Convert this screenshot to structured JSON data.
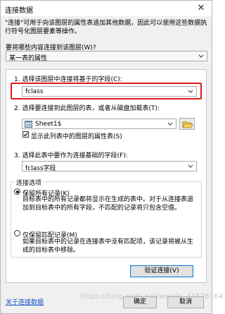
{
  "window": {
    "title": "连接数据",
    "close_glyph": "✕"
  },
  "description": "\"连接\"可用于向该图层的属性表追加其他数据，因此可以使用这些数据执行符号化图层要素等操作。",
  "what_to_join": {
    "label": "要将哪些内容连接到该图层(W)?",
    "value": "某一表的属性"
  },
  "step1": {
    "label": "1. 选择该图层中连接将基于的字段(C):",
    "value": "fclass"
  },
  "step2": {
    "label": "2. 选择要连接到此图层的表，或者从磁盘加载表(T):",
    "value": "Sheet1$",
    "show_attrs_label": "显示此列表中的图层的属性表(S)",
    "show_attrs_checked": true
  },
  "step3": {
    "label": "3. 选择此表中要作为连接基础的字段(F):",
    "value": "fclass字段"
  },
  "join_options": {
    "title": "连接选项",
    "keep_all": {
      "label": "保留所有记录(K)",
      "desc": "目标表中的所有记录都将显示在生成的表中。对于从连接表追加到目标表中的所有字段，不匹配的记录将只包含空值。",
      "selected": true
    },
    "keep_matching": {
      "label": "仅保留匹配记录(M)",
      "desc": "如果目标表中的记录在连接表中没有匹配项，该记录将被从生成的目标表中移除。",
      "selected": false
    }
  },
  "buttons": {
    "validate": "验证连接(V)",
    "ok": "确定",
    "cancel": "取消"
  },
  "footer": {
    "about_link": "关于连接数据",
    "watermark": "https://blog.csdn.net/weixin_43528164"
  },
  "colors": {
    "highlight": "#e21a1a",
    "link": "#1a56c9",
    "focus_border": "#0078d7"
  }
}
